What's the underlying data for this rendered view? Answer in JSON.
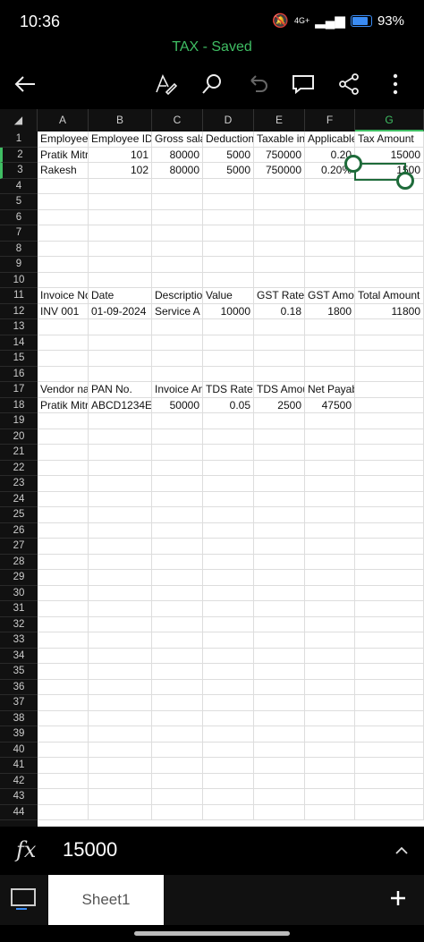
{
  "status": {
    "time": "10:36",
    "network": "4G+",
    "battery": "93%"
  },
  "title": "TAX - Saved",
  "toolbar": {
    "back_icon": "arrow-left-icon",
    "format_icon": "draw-pen-icon",
    "search_icon": "search-icon",
    "undo_icon": "undo-icon",
    "comment_icon": "comment-icon",
    "share_icon": "share-icon",
    "more_icon": "more-vertical-icon"
  },
  "columns": [
    "A",
    "B",
    "C",
    "D",
    "E",
    "F",
    "G"
  ],
  "selected_column": "G",
  "rows": [
    1,
    2,
    3,
    4,
    5,
    6,
    7,
    8,
    9,
    10,
    11,
    12,
    13,
    14,
    15,
    16,
    17,
    18,
    19,
    20,
    21,
    22,
    23,
    24,
    25,
    26,
    27,
    28,
    29,
    30,
    31,
    32,
    33,
    34,
    35,
    36,
    37,
    38,
    39,
    40,
    41,
    42,
    43,
    44
  ],
  "cells": {
    "r1": [
      "Employee",
      "Employee ID",
      "Gross sala",
      "Deduction",
      "Taxable in",
      "Applicable",
      "Tax Amount"
    ],
    "r2": [
      "Pratik Mitr",
      "101",
      "80000",
      "5000",
      "750000",
      "0.20",
      "15000"
    ],
    "r3": [
      "Rakesh",
      "102",
      "80000",
      "5000",
      "750000",
      "0.20%",
      "1500"
    ],
    "r11": [
      "Invoice No",
      "Date",
      "Descriptio",
      "Value",
      "GST Rate",
      "GST Amou",
      "Total Amount"
    ],
    "r12": [
      "INV 001",
      "01-09-2024",
      "Service A",
      "10000",
      "0.18",
      "1800",
      "11800"
    ],
    "r17": [
      "Vendor na",
      "PAN No.",
      "Invoice An",
      "TDS Rate",
      "TDS Amou",
      "Net Payable",
      ""
    ],
    "r18": [
      "Pratik Mitr",
      "ABCD1234E",
      "50000",
      "0.05",
      "2500",
      "47500",
      ""
    ]
  },
  "formula_bar": {
    "label": "fx",
    "value": "15000",
    "collapse_icon": "chevron-up-icon"
  },
  "bottom": {
    "sheet_tab": "Sheet1",
    "add_icon": "plus-icon",
    "sheets_icon": "sheet-overview-icon"
  }
}
